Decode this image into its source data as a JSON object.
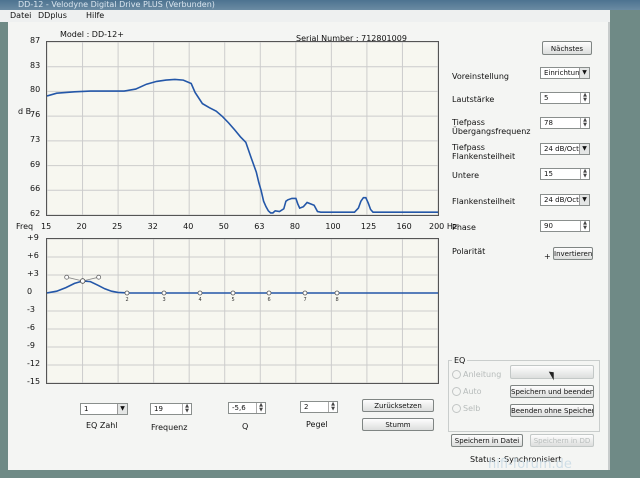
{
  "window": {
    "title": "DD-12 - Velodyne Digital Drive PLUS (Verbunden)"
  },
  "menu": [
    "Datei",
    "DDplus",
    "Hilfe"
  ],
  "header": {
    "model": "Model : DD-12+",
    "serial": "Serial Number : 712801009"
  },
  "graph_top": {
    "ylabel": "d B",
    "y_ticks": [
      "87",
      "83",
      "80",
      "76",
      "73",
      "69",
      "66",
      "62"
    ],
    "x_ticks": [
      "15",
      "20",
      "25",
      "32",
      "40",
      "50",
      "63",
      "80",
      "100",
      "125",
      "160",
      "200 Hz"
    ]
  },
  "graph_bottom": {
    "ylabel": "Freq",
    "y_ticks": [
      "+9",
      "+6",
      "+3",
      "0",
      "-3",
      "-6",
      "-9",
      "-12",
      "-15"
    ],
    "markers": [
      "1",
      "2",
      "3",
      "4",
      "5",
      "6",
      "7",
      "8"
    ]
  },
  "right_panel": {
    "next_button": "Nächstes",
    "voreinstellung_label": "Voreinstellung",
    "voreinstellung_value": "Einrichtung",
    "lautstaerke_label": "Lautstärke",
    "lautstaerke_value": "5",
    "tiefpass_label": "Tiefpass\nÜbergangsfrequenz",
    "tiefpass_value": "78",
    "flanken_label": "Tiefpass\nFlankensteilheit",
    "flanken_value": "24 dB/Oct",
    "untere_label": "Untere",
    "untere_value": "15",
    "flanken2_label": "Flankensteilheit",
    "flanken2_value": "24 dB/Oct",
    "phase_label": "Phase",
    "phase_value": "90",
    "polaritaet_label": "Polarität",
    "polaritaet_plus": "+",
    "invert_button": "Invertieren"
  },
  "eq_group": {
    "title": "EQ",
    "radio1": "Anleitung",
    "radio2": "Auto",
    "radio3": "Selb",
    "btn_top": "",
    "btn_save_quit": "Speichern und beenden",
    "btn_quit_nosave": "Beenden ohne Speichern"
  },
  "bottom_controls": {
    "eq_zahl_value": "1",
    "eq_zahl_label": "EQ Zahl",
    "frequenz_value": "19",
    "frequenz_label": "Frequenz",
    "q_value": "-5,6",
    "q_label": "Q",
    "pegel_value": "2",
    "pegel_label": "Pegel",
    "reset_button": "Zurücksetzen",
    "mute_button": "Stumm"
  },
  "footer": {
    "save_file_button": "Speichern in Datei",
    "disabled_button": "Speichern in DD",
    "status_label": "Status :",
    "status_value": "Synchronisiert"
  },
  "watermark": "hifi-forum.de",
  "colors": {
    "curve": "#2457a8",
    "grid": "#cccccc",
    "window_bg": "#f4f5f3"
  },
  "chart_data": [
    {
      "type": "line",
      "title": "",
      "xlabel": "",
      "ylabel": "d B",
      "x_scale": "log",
      "xlim": [
        15,
        200
      ],
      "ylim": [
        62,
        87
      ],
      "x": [
        15,
        16,
        18,
        20,
        22,
        25,
        27,
        29,
        31,
        33,
        35,
        37,
        39,
        40,
        42,
        44,
        46,
        48,
        50,
        52,
        54,
        56,
        58,
        60,
        61,
        62,
        63,
        64,
        65,
        66,
        67,
        68,
        70,
        72,
        73,
        74,
        76,
        78,
        79,
        80,
        82,
        84,
        86,
        88,
        90,
        92,
        95,
        100,
        105,
        110,
        115,
        118,
        120,
        122,
        124,
        126,
        128,
        130,
        135,
        140,
        150,
        160,
        180,
        200
      ],
      "series": [
        {
          "name": "",
          "values": [
            79.2,
            79.6,
            79.8,
            79.9,
            79.9,
            79.9,
            80.2,
            80.9,
            81.3,
            81.5,
            81.6,
            81.5,
            81.0,
            79.7,
            78.1,
            77.5,
            77.0,
            76.2,
            75.3,
            74.3,
            73.3,
            72.5,
            70.3,
            68.2,
            66.7,
            65.5,
            64.0,
            63.2,
            62.6,
            62.3,
            62.3,
            62.6,
            62.5,
            62.9,
            64.0,
            64.2,
            64.4,
            64.4,
            63.6,
            63.0,
            63.2,
            63.8,
            63.6,
            63.4,
            62.5,
            62.4,
            62.4,
            62.4,
            62.4,
            62.4,
            62.4,
            63.0,
            64.0,
            64.5,
            64.5,
            63.7,
            62.8,
            62.4,
            62.4,
            62.4,
            62.4,
            62.4,
            62.4,
            62.4
          ]
        }
      ]
    },
    {
      "type": "line",
      "title": "",
      "xlabel": "",
      "ylabel": "Freq",
      "x_scale": "log",
      "xlim": [
        15,
        200
      ],
      "ylim": [
        -15,
        9
      ],
      "x": [
        15,
        16,
        17,
        18,
        19,
        20,
        21,
        22,
        23,
        24,
        26,
        30,
        40,
        60,
        100,
        200
      ],
      "series": [
        {
          "name": "",
          "values": [
            0.0,
            0.3,
            0.9,
            1.6,
            2.0,
            1.9,
            1.3,
            0.7,
            0.3,
            0.1,
            0.0,
            0.0,
            0.0,
            0.0,
            0.0,
            0.0
          ]
        }
      ]
    }
  ]
}
